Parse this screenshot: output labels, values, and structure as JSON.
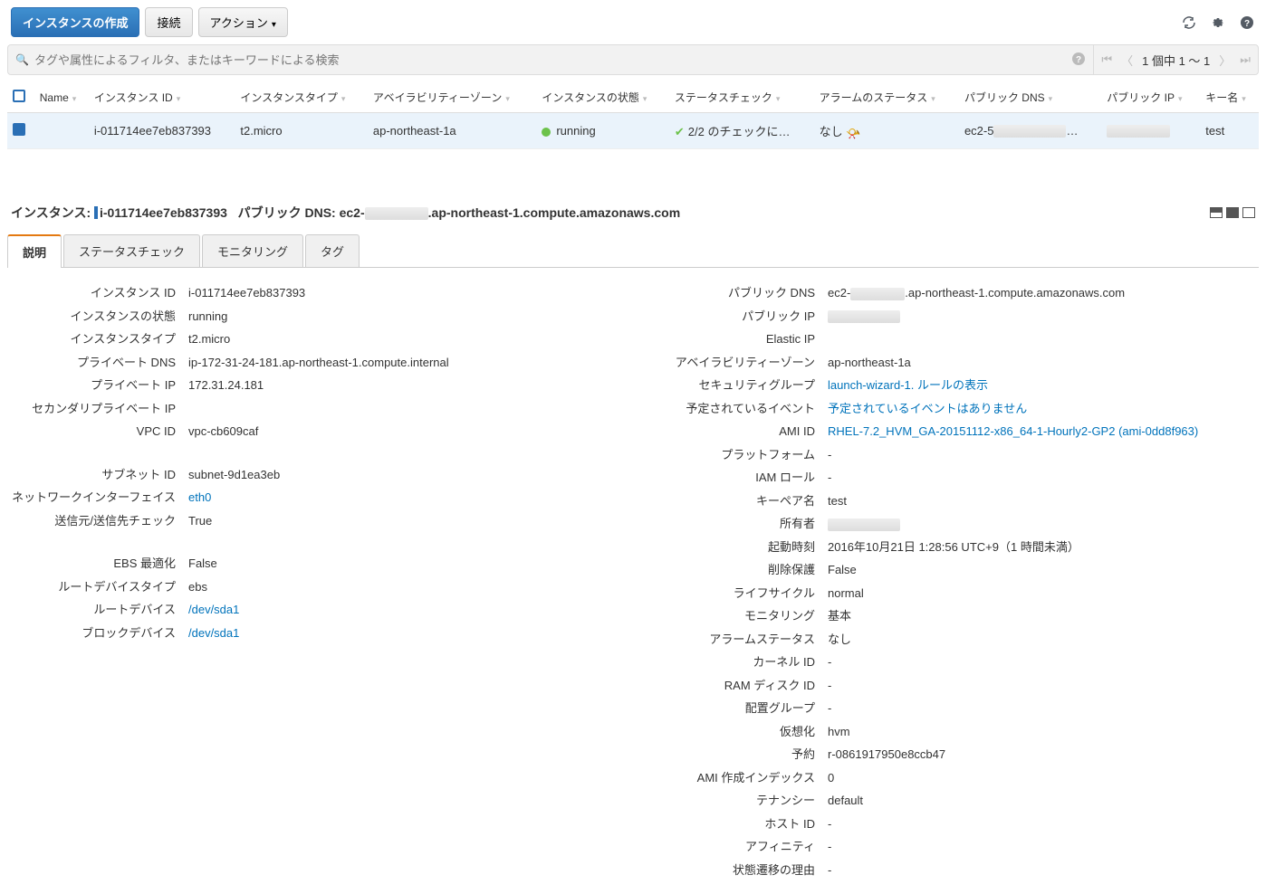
{
  "toolbar": {
    "launch": "インスタンスの作成",
    "connect": "接続",
    "actions": "アクション"
  },
  "filter": {
    "placeholder": "タグや属性によるフィルタ、またはキーワードによる検索",
    "page_info": "1 個中 1 ～ 1"
  },
  "columns": [
    "Name",
    "インスタンス ID",
    "インスタンスタイプ",
    "アベイラビリティーゾーン",
    "インスタンスの状態",
    "ステータスチェック",
    "アラームのステータス",
    "パブリック DNS",
    "パブリック IP",
    "キー名"
  ],
  "row": {
    "name": "",
    "id": "i-011714ee7eb837393",
    "type": "t2.micro",
    "az": "ap-northeast-1a",
    "state": "running",
    "check": "2/2 のチェックに…",
    "alarm": "なし",
    "dns_prefix": "ec2-5",
    "dns_ellipsis": "…",
    "key": "test"
  },
  "summary": {
    "label_instance": "インスタンス:",
    "instance_id": "i-011714ee7eb837393",
    "label_dns": "パブリック DNS:",
    "dns_prefix": "ec2-",
    "dns_suffix": ".ap-northeast-1.compute.amazonaws.com"
  },
  "tabs": [
    "説明",
    "ステータスチェック",
    "モニタリング",
    "タグ"
  ],
  "left": [
    {
      "k": "インスタンス ID",
      "v": "i-011714ee7eb837393"
    },
    {
      "k": "インスタンスの状態",
      "v": "running"
    },
    {
      "k": "インスタンスタイプ",
      "v": "t2.micro"
    },
    {
      "k": "プライベート DNS",
      "v": "ip-172-31-24-181.ap-northeast-1.compute.internal"
    },
    {
      "k": "プライベート IP",
      "v": "172.31.24.181"
    },
    {
      "k": "セカンダリプライベート IP",
      "v": ""
    },
    {
      "k": "VPC ID",
      "v": "vpc-cb609caf"
    },
    {
      "gap": true
    },
    {
      "k": "サブネット ID",
      "v": "subnet-9d1ea3eb"
    },
    {
      "k": "ネットワークインターフェイス",
      "v": "eth0",
      "link": true
    },
    {
      "k": "送信元/送信先チェック",
      "v": "True"
    },
    {
      "gap": true
    },
    {
      "k": "EBS 最適化",
      "v": "False"
    },
    {
      "k": "ルートデバイスタイプ",
      "v": "ebs"
    },
    {
      "k": "ルートデバイス",
      "v": "/dev/sda1",
      "link": true
    },
    {
      "k": "ブロックデバイス",
      "v": "/dev/sda1",
      "link": true
    }
  ],
  "right": [
    {
      "k": "パブリック DNS",
      "v_pre": "ec2-",
      "v_post": ".ap-northeast-1.compute.amazonaws.com",
      "redact": 60
    },
    {
      "k": "パブリック IP",
      "redact": 80
    },
    {
      "k": "Elastic IP",
      "v": ""
    },
    {
      "k": "アベイラビリティーゾーン",
      "v": "ap-northeast-1a"
    },
    {
      "k": "セキュリティグループ",
      "v": "launch-wizard-1",
      "link": true,
      "v_extra": ". ルールの表示",
      "link_extra": true
    },
    {
      "k": "予定されているイベント",
      "v": "予定されているイベントはありません",
      "link": true
    },
    {
      "k": "AMI ID",
      "v": "RHEL-7.2_HVM_GA-20151112-x86_64-1-Hourly2-GP2 (ami-0dd8f963)",
      "link": true
    },
    {
      "k": "プラットフォーム",
      "v": "-"
    },
    {
      "k": "IAM ロール",
      "v": "-"
    },
    {
      "k": "キーペア名",
      "v": "test"
    },
    {
      "k": "所有者",
      "redact": 80
    },
    {
      "k": "起動時刻",
      "v": "2016年10月21日 1:28:56 UTC+9（1 時間未満）"
    },
    {
      "k": "削除保護",
      "v": "False"
    },
    {
      "k": "ライフサイクル",
      "v": "normal"
    },
    {
      "k": "モニタリング",
      "v": "基本"
    },
    {
      "k": "アラームステータス",
      "v": "なし"
    },
    {
      "k": "カーネル ID",
      "v": "-"
    },
    {
      "k": "RAM ディスク ID",
      "v": "-"
    },
    {
      "k": "配置グループ",
      "v": "-"
    },
    {
      "k": "仮想化",
      "v": "hvm"
    },
    {
      "k": "予約",
      "v": "r-0861917950e8ccb47"
    },
    {
      "k": "AMI 作成インデックス",
      "v": "0"
    },
    {
      "k": "テナンシー",
      "v": "default"
    },
    {
      "k": "ホスト ID",
      "v": "-"
    },
    {
      "k": "アフィニティ",
      "v": "-"
    },
    {
      "k": "状態遷移の理由",
      "v": "-"
    }
  ]
}
